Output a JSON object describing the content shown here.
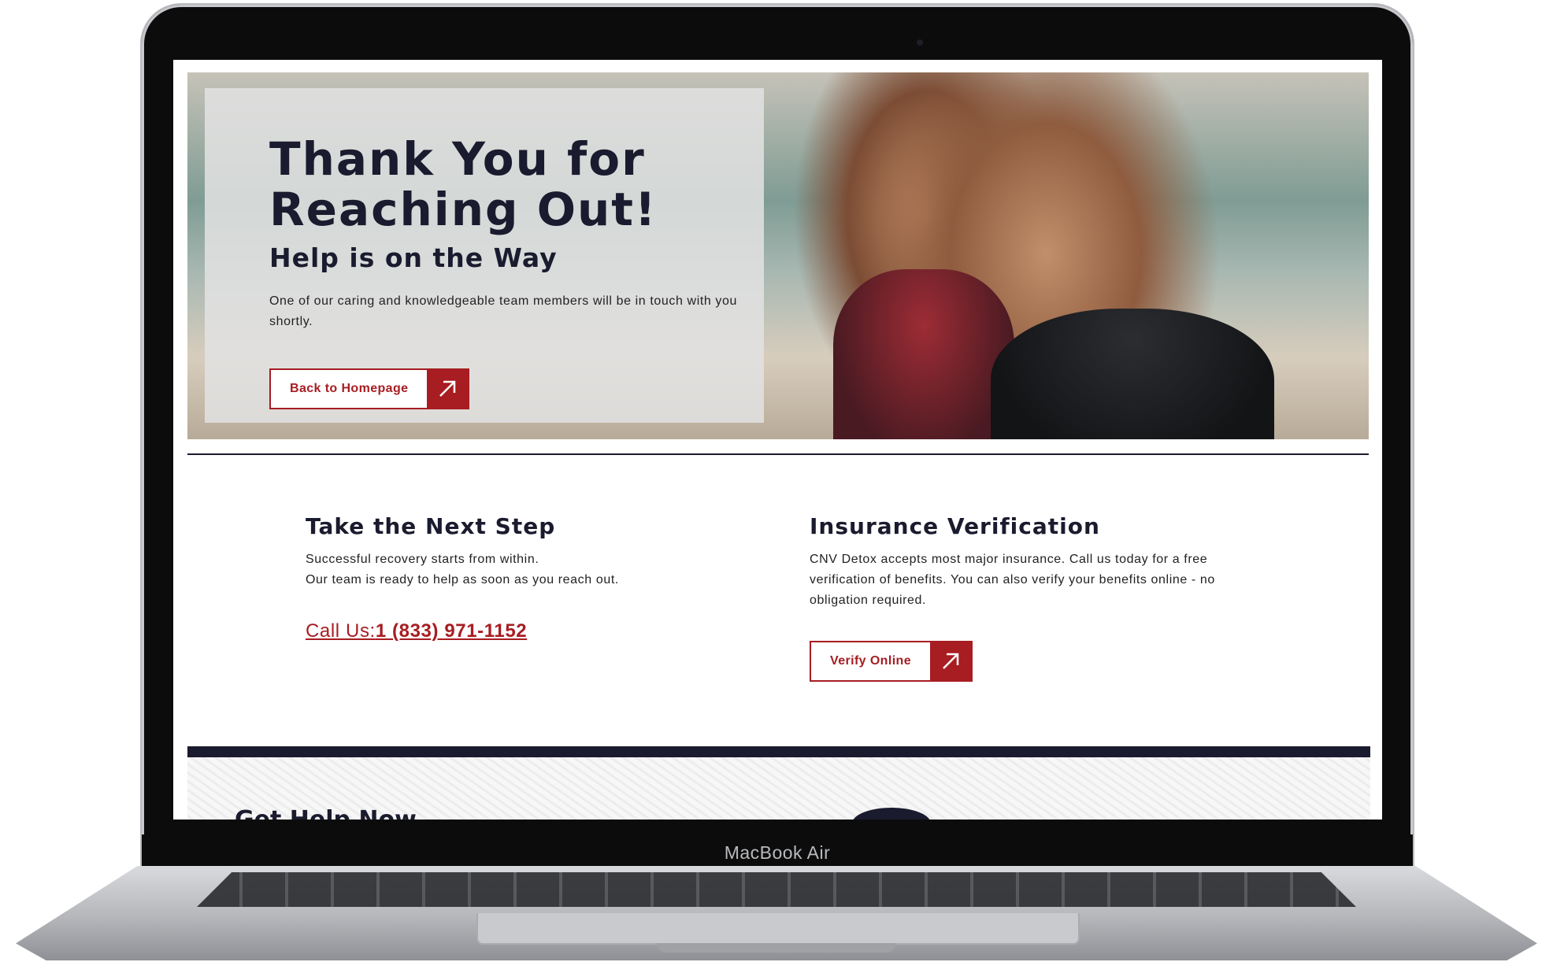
{
  "device": {
    "model_label": "MacBook Air"
  },
  "hero": {
    "title": "Thank You for\nReaching Out!",
    "subtitle": "Help is on the Way",
    "body": "One of our caring and knowledgeable team members will be in touch with you shortly.",
    "button_label": "Back to Homepage",
    "button_icon": "arrow-up-right-icon"
  },
  "next_step": {
    "title": "Take the Next Step",
    "line1": "Successful recovery starts from within.",
    "line2": "Our team is ready to help as soon as you reach out.",
    "call_prefix": "Call Us:",
    "phone": "1 (833) 971-1152"
  },
  "insurance": {
    "title": "Insurance Verification",
    "body": "CNV Detox accepts most major insurance. Call us today for a free verification of benefits. You can also verify your benefits online - no obligation required.",
    "button_label": "Verify Online",
    "button_icon": "arrow-up-right-icon"
  },
  "footer_preview": {
    "heading": "Get Help Now"
  },
  "colors": {
    "accent": "#a71d22",
    "navy": "#1a1b2e",
    "overlay": "#e2e2e2"
  }
}
